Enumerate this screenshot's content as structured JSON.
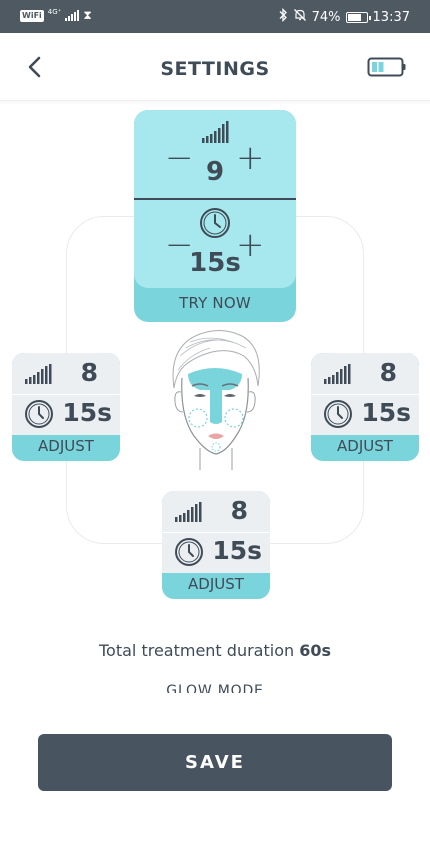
{
  "status_bar": {
    "wifi_label": "WiFi",
    "network_label": "4G⁺",
    "battery_percent": "74%",
    "time": "13:37"
  },
  "header": {
    "title": "SETTINGS",
    "back_icon": "chevron-left-icon",
    "device_battery_icon": "battery-icon"
  },
  "zones": {
    "forehead": {
      "intensity": "9",
      "duration": "15s",
      "action_label": "TRY NOW"
    },
    "left_cheek": {
      "intensity": "8",
      "duration": "15s",
      "action_label": "ADJUST"
    },
    "right_cheek": {
      "intensity": "8",
      "duration": "15s",
      "action_label": "ADJUST"
    },
    "chin": {
      "intensity": "8",
      "duration": "15s",
      "action_label": "ADJUST"
    }
  },
  "summary": {
    "total_label": "Total treatment duration",
    "total_value": "60s"
  },
  "glow_mode_label": "GLOW MODE",
  "save_label": "SAVE",
  "colors": {
    "accent": "#79d4db",
    "accent_light": "#a6e8ed",
    "text_dark": "#3f4b57",
    "button_dark": "#485561",
    "status_bar": "#4f5962"
  }
}
